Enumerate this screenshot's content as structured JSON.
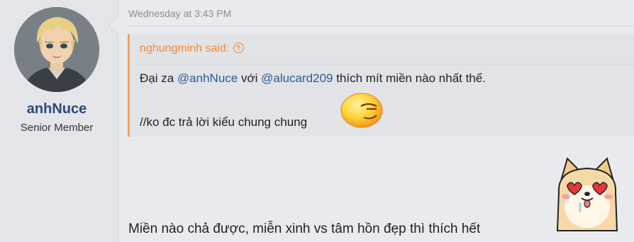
{
  "author": {
    "name": "anhNuce",
    "title": "Senior Member"
  },
  "post": {
    "date": "Wednesday at 3:43 PM",
    "quote": {
      "author_said": "nghungminh said:",
      "line1_prefix": "Đại za ",
      "mention1": "@anhNuce",
      "line1_mid": " với ",
      "mention2": "@alucard209",
      "line1_suffix": " thích mít miền nào nhất thế.",
      "line2": "//ko đc trả lời kiểu chung chung"
    },
    "reply": "Miền nào chả được, miễn xinh vs tâm hồn đẹp thì thích hết"
  },
  "icons": {
    "quote_jump": "arrow-up-circle-icon",
    "smiley": "smirk-smiley-icon",
    "sticker": "heart-eyes-dog-sticker"
  },
  "colors": {
    "username": "#2c4a78",
    "quote_accent": "#ef8a3e",
    "mention": "#2f5a97"
  }
}
